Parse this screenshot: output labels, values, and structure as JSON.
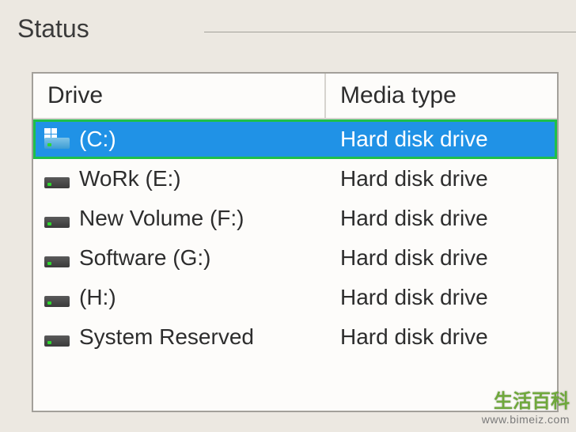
{
  "section_title": "Status",
  "columns": {
    "drive": "Drive",
    "media_type": "Media type"
  },
  "drives": [
    {
      "label": "(C:)",
      "media": "Hard disk drive",
      "selected": true,
      "os_drive": true
    },
    {
      "label": "WoRk (E:)",
      "media": "Hard disk drive",
      "selected": false,
      "os_drive": false
    },
    {
      "label": "New Volume (F:)",
      "media": "Hard disk drive",
      "selected": false,
      "os_drive": false
    },
    {
      "label": "Software (G:)",
      "media": "Hard disk drive",
      "selected": false,
      "os_drive": false
    },
    {
      "label": "(H:)",
      "media": "Hard disk drive",
      "selected": false,
      "os_drive": false
    },
    {
      "label": "System Reserved",
      "media": "Hard disk drive",
      "selected": false,
      "os_drive": false
    }
  ],
  "watermark": {
    "logo_text": "生活百科",
    "url": "www.bimeiz.com"
  }
}
